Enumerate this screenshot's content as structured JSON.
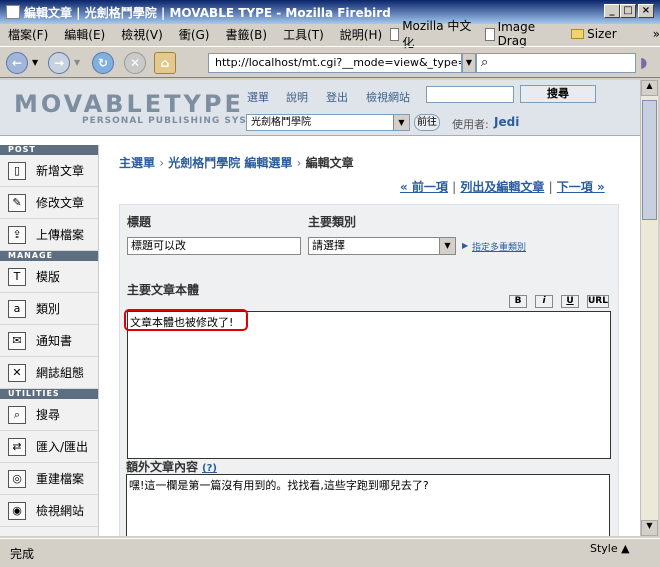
{
  "window": {
    "title": "編輯文章 | 光劍格鬥學院 | MOVABLE TYPE - Mozilla Firebird"
  },
  "menu": [
    "檔案(F)",
    "編輯(E)",
    "檢視(V)",
    "衝(G)",
    "書籤(B)",
    "工具(T)",
    "說明(H)"
  ],
  "bookmarks": [
    {
      "label": "Mozilla 中文化",
      "icon": "page-icon"
    },
    {
      "label": "Image Drag",
      "icon": "page-icon"
    },
    {
      "label": "Sizer",
      "icon": "folder-icon"
    }
  ],
  "overflow": "»",
  "address": {
    "url": "http://localhost/mt.cgi?__mode=view&_type=entry&"
  },
  "mt": {
    "logo": "MOVABLETYPE",
    "logo_sub": "PERSONAL PUBLISHING SYSTEM",
    "links": [
      "選單",
      "說明",
      "登出",
      "檢視網站"
    ],
    "search_button": "搜尋",
    "blog_select": "光劍格鬥學院",
    "go_button": "前往",
    "user_label": "使用者:",
    "user_name": "Jedi"
  },
  "sidebar": {
    "sections": [
      {
        "title": "POST",
        "items": [
          "新增文章",
          "修改文章",
          "上傳檔案"
        ]
      },
      {
        "title": "MANAGE",
        "items": [
          "模版",
          "類別",
          "通知書",
          "網誌組態"
        ]
      },
      {
        "title": "UTILITIES",
        "items": [
          "搜尋",
          "匯入/匯出",
          "重建檔案",
          "檢視網站"
        ]
      }
    ]
  },
  "breadcrumb": {
    "home": "主選單",
    "blog": "光劍格鬥學院 編輯選單",
    "current": "編輯文章",
    "sep": "›"
  },
  "pager": {
    "prev": "« 前一項",
    "list": "列出及編輯文章",
    "next": "下一項 »",
    "sep": "|"
  },
  "form": {
    "title_label": "標題",
    "title_value": "標題可以改",
    "category_label": "主要類別",
    "category_value": "請選擇",
    "multi_cat_link": "指定多重類別",
    "body_label": "主要文章本體",
    "format_buttons": [
      "B",
      "i",
      "U",
      "URL"
    ],
    "body_value": "文章本體也被修改了!",
    "ext_label": "額外文章內容",
    "ext_help": "(?)",
    "ext_value": "嘿!這一欄是第一篇沒有用到的。找找看,這些字跑到哪兒去了?"
  },
  "status": {
    "text": "完成",
    "sizer": "Style"
  }
}
